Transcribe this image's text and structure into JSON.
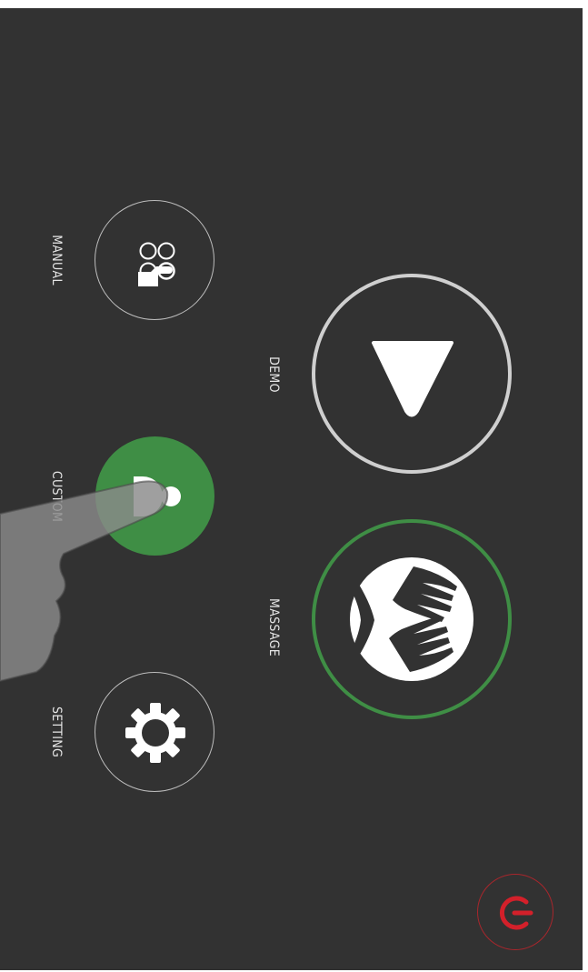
{
  "menu": {
    "manual": {
      "label": "MANUAL",
      "icon": "manual-select-icon"
    },
    "custom": {
      "label": "CUSTOM",
      "icon": "custom-icon",
      "active": true
    },
    "setting": {
      "label": "SETTING",
      "icon": "gear-icon"
    }
  },
  "actions": {
    "demo": {
      "label": "DEMO",
      "icon": "play-triangle-icon"
    },
    "massage": {
      "label": "MASSAGE",
      "icon": "massage-hands-icon"
    }
  },
  "power": {
    "icon": "power-icon"
  },
  "colors": {
    "background": "#323232",
    "accent_green": "#3f8e45",
    "ring_gray": "#cfcfcf",
    "power_red": "#d3202a",
    "text": "#e6e6e6"
  }
}
